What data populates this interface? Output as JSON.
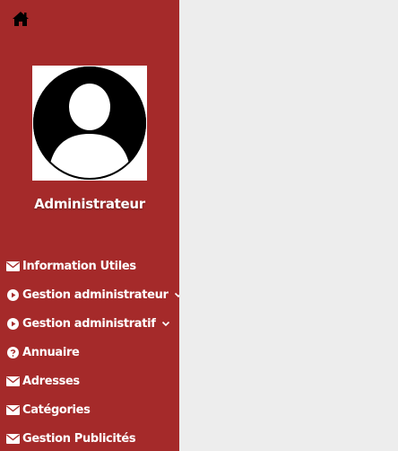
{
  "sidebar": {
    "home_icon": "home-icon",
    "avatar_icon": "user-avatar-icon",
    "admin_name": "Administrateur",
    "menu": [
      {
        "label": "Information Utiles",
        "icon": "envelope-icon",
        "has_submenu": false
      },
      {
        "label": "Gestion administrateur",
        "icon": "play-circle-icon",
        "has_submenu": true
      },
      {
        "label": "Gestion administratif",
        "icon": "play-circle-icon",
        "has_submenu": true
      },
      {
        "label": "Annuaire",
        "icon": "question-circle-icon",
        "has_submenu": false
      },
      {
        "label": "Adresses",
        "icon": "envelope-icon",
        "has_submenu": false
      },
      {
        "label": "Catégories",
        "icon": "envelope-icon",
        "has_submenu": false
      },
      {
        "label": "Gestion Publicités",
        "icon": "envelope-icon",
        "has_submenu": false
      }
    ]
  },
  "colors": {
    "sidebar_bg": "#a52a2a",
    "content_bg": "#ededed",
    "text": "#ffffff"
  }
}
